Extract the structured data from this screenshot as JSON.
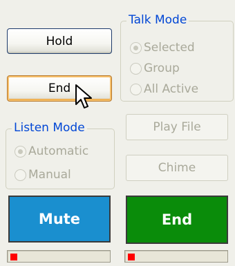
{
  "left_panel": {
    "hold_label": "Hold",
    "end_label": "End",
    "listen_mode": {
      "legend": "Listen Mode",
      "options": [
        {
          "label": "Automatic",
          "selected": true
        },
        {
          "label": "Manual",
          "selected": false
        }
      ]
    },
    "mute_label": "Mute",
    "mute_color": "#1a8fcf",
    "meter_level_color": "#ff0000"
  },
  "right_panel": {
    "talk_mode": {
      "legend": "Talk Mode",
      "options": [
        {
          "label": "Selected",
          "selected": true
        },
        {
          "label": "Group",
          "selected": false
        },
        {
          "label": "All Active",
          "selected": false
        }
      ]
    },
    "play_file_label": "Play File",
    "chime_label": "Chime",
    "end_label": "End",
    "end_color": "#0a8c0a",
    "meter_level_color": "#ff0000"
  },
  "cursor_icon": "arrow-pointer-icon"
}
